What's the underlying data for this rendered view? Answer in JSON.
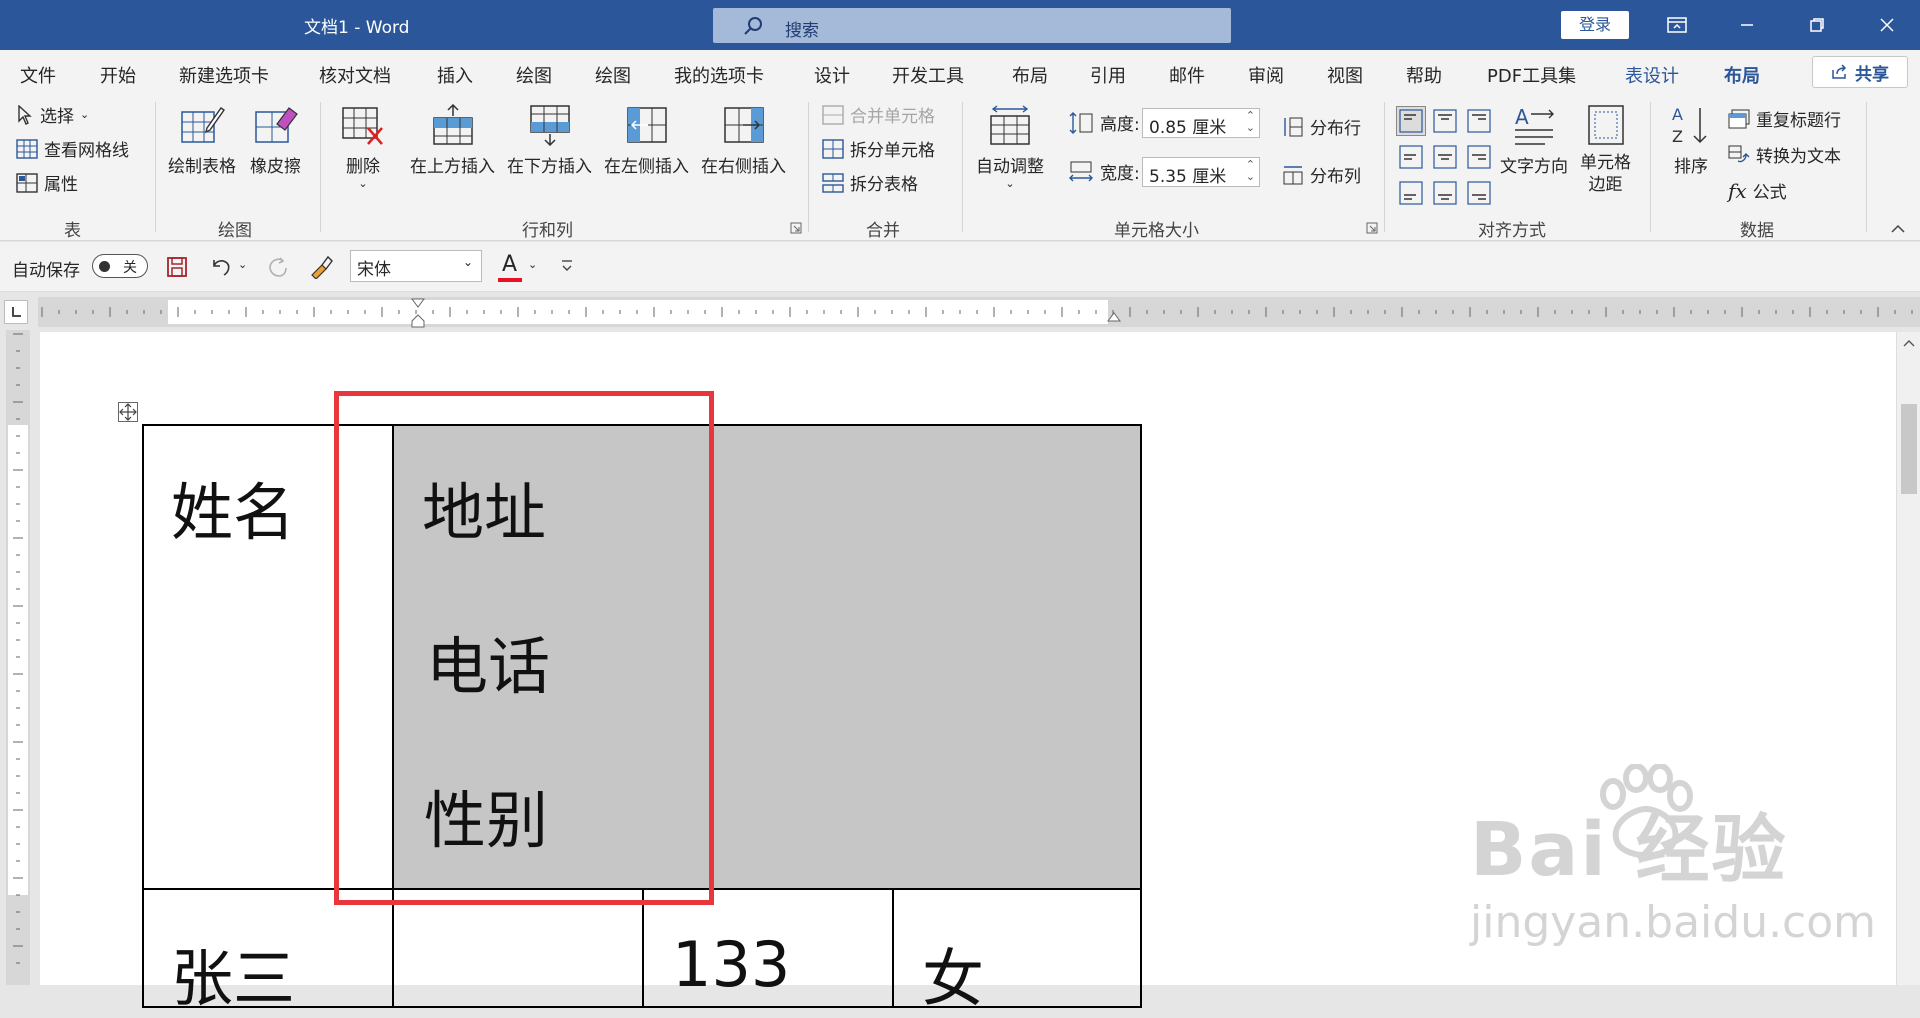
{
  "titlebar": {
    "doc_title": "文档1  -  Word",
    "search_text": "搜索",
    "login_label": "登录"
  },
  "tabs": [
    "文件",
    "开始",
    "新建选项卡",
    "核对文档",
    "插入",
    "绘图",
    "绘图",
    "我的选项卡",
    "设计",
    "开发工具",
    "布局",
    "引用",
    "邮件",
    "审阅",
    "视图",
    "帮助",
    "PDF工具集",
    "表设计",
    "布局"
  ],
  "share_label": "共享",
  "ribbon": {
    "table_group": {
      "select": "选择",
      "view_gridlines": "查看网格线",
      "properties": "属性",
      "label": "表"
    },
    "draw_group": {
      "draw_table": "绘制表格",
      "eraser": "橡皮擦",
      "label": "绘图"
    },
    "rows_cols_group": {
      "delete": "删除",
      "insert_above": "在上方插入",
      "insert_below": "在下方插入",
      "insert_left": "在左侧插入",
      "insert_right": "在右侧插入",
      "label": "行和列"
    },
    "merge_group": {
      "merge_cells": "合并单元格",
      "split_cells": "拆分单元格",
      "split_table": "拆分表格",
      "label": "合并"
    },
    "cell_size_group": {
      "autofit": "自动调整",
      "height_label": "高度:",
      "height_value": "0.85 厘米",
      "width_label": "宽度:",
      "width_value": "5.35 厘米",
      "distribute_rows": "分布行",
      "distribute_cols": "分布列",
      "label": "单元格大小"
    },
    "align_group": {
      "text_direction": "文字方向",
      "cell_margins_1": "单元格",
      "cell_margins_2": "边距",
      "label": "对齐方式"
    },
    "data_group": {
      "sort": "排序",
      "repeat_header": "重复标题行",
      "convert_text": "转换为文本",
      "formula": "公式",
      "label": "数据"
    }
  },
  "qat": {
    "autosave": "自动保存",
    "toggle_state": "关",
    "font_name": "宋体"
  },
  "document": {
    "row1": {
      "name": "姓名",
      "address": "地址",
      "phone": "电话",
      "gender": "性别"
    },
    "row2": {
      "name": "张三",
      "phone": "133",
      "gender": "女"
    }
  },
  "watermark": {
    "brand": "Bai  经验",
    "url": "jingyan.baidu.com"
  },
  "colors": {
    "accent": "#2b579a",
    "highlight_box": "#e8373c",
    "cell_shading": "#c6c6c6"
  }
}
